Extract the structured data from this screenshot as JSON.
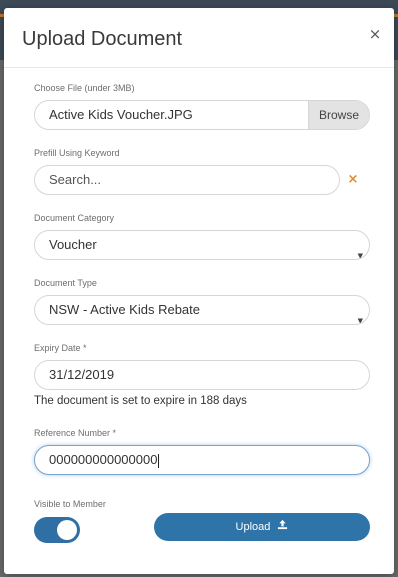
{
  "modal": {
    "title": "Upload Document",
    "close_icon": "close-icon",
    "close_glyph": "×"
  },
  "file": {
    "label": "Choose File (under 3MB)",
    "value": "Active Kids Voucher.JPG",
    "browse_label": "Browse"
  },
  "prefill": {
    "label": "Prefill Using Keyword",
    "value": "Search...",
    "clear_icon": "close-icon",
    "clear_glyph": "×"
  },
  "category": {
    "label": "Document Category",
    "selected": "Voucher",
    "caret_icon": "chevron-down-icon"
  },
  "doc_type": {
    "label": "Document Type",
    "selected": "NSW - Active Kids Rebate",
    "caret_icon": "chevron-down-icon"
  },
  "expiry": {
    "label": "Expiry Date *",
    "value": "31/12/2019",
    "note": "The document is set to expire in 188 days"
  },
  "reference": {
    "label": "Reference Number *",
    "value": "000000000000000"
  },
  "visibility": {
    "label": "Visible to Member",
    "enabled": true
  },
  "upload": {
    "label": "Upload",
    "icon": "upload-icon"
  },
  "colors": {
    "primary": "#2f74a8",
    "clear_accent": "#e08a2a",
    "focus_border": "#7ba3c9"
  }
}
